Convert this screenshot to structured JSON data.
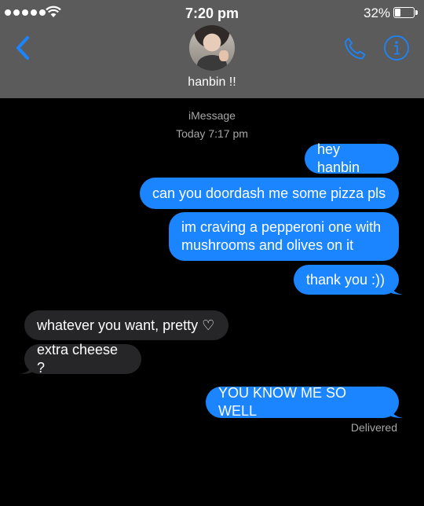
{
  "status_bar": {
    "time": "7:20 pm",
    "battery": "32%",
    "battery_level": 0.32
  },
  "header": {
    "contact_name": "hanbin !!"
  },
  "thread": {
    "service": "iMessage",
    "timestamp": "Today 7:17 pm"
  },
  "messages": [
    {
      "from": "me",
      "text": "hey hanbin"
    },
    {
      "from": "me",
      "text": "can you doordash me some pizza pls"
    },
    {
      "from": "me",
      "text": "im craving a pepperoni one with\nmushrooms and olives on it"
    },
    {
      "from": "me",
      "text": "thank you :))"
    },
    {
      "from": "them",
      "text": "whatever you want, pretty ♡"
    },
    {
      "from": "them",
      "text": "extra cheese ?"
    },
    {
      "from": "me",
      "text": "YOU KNOW ME SO WELL"
    }
  ],
  "delivery_status": "Delivered",
  "colors": {
    "sent_bubble": "#1a85ff",
    "received_bubble": "#262628",
    "accent": "#1a85ff",
    "header_bg": "#5b5b5b"
  },
  "icons": {
    "back": "chevron-left-icon",
    "call": "phone-icon",
    "info": "info-icon",
    "wifi": "wifi-icon"
  }
}
